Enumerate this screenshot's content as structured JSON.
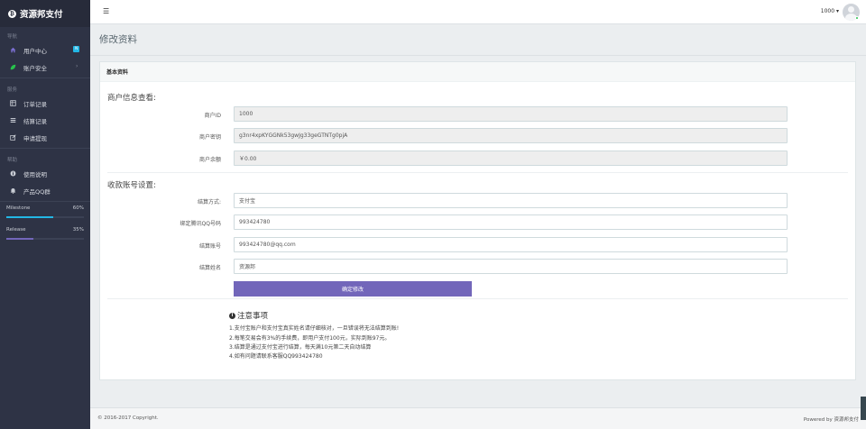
{
  "brand": {
    "logo_glyph": "₿",
    "name": "资源邦支付"
  },
  "sidebar": {
    "sections": [
      {
        "label": "导航"
      },
      {
        "label": "服务"
      },
      {
        "label": "帮助"
      }
    ],
    "items": [
      {
        "label": "用户中心",
        "icon": "home-icon",
        "badge": "N"
      },
      {
        "label": "账户安全",
        "icon": "leaf-icon",
        "arrow": "›"
      },
      {
        "label": "订单记录",
        "icon": "table-icon"
      },
      {
        "label": "结算记录",
        "icon": "list-icon"
      },
      {
        "label": "申请提现",
        "icon": "edit-icon"
      },
      {
        "label": "使用说明",
        "icon": "help-circle-icon"
      },
      {
        "label": "产品QQ群",
        "icon": "bell-icon"
      }
    ],
    "progress": [
      {
        "label": "Milestone",
        "value": "60%",
        "fraction": 0.6,
        "color": "#23b7e5"
      },
      {
        "label": "Release",
        "value": "35%",
        "fraction": 0.35,
        "color": "#7266ba"
      }
    ]
  },
  "topbar": {
    "menu_icon": "☰",
    "user_id": "1000 ▾"
  },
  "page": {
    "title": "修改资料"
  },
  "panel": {
    "heading": "基本资料",
    "merchant_section": "商户信息查看:",
    "merchant_fields": [
      {
        "label": "商户ID",
        "value": "1000"
      },
      {
        "label": "商户密钥",
        "value": "g3nr4xpKYGGNk53gwJg33geGTNTg0pjA"
      },
      {
        "label": "商户余额",
        "value": "￥0.00"
      }
    ],
    "account_section": "收款账号设置:",
    "account_fields": [
      {
        "label": "结算方式:",
        "value": "支付宝"
      },
      {
        "label": "绑定腾讯QQ号码",
        "value": "993424780"
      },
      {
        "label": "结算账号",
        "value": "993424780@qq.com"
      },
      {
        "label": "结算姓名",
        "value": "资源邦"
      }
    ],
    "submit_label": "确定修改",
    "notice_title": "注意事项",
    "notice_lines": [
      "1.支付宝账户和支付宝真实姓名请仔细核对，一旦错误将无法结算到账!",
      "2.每笔交易会有3%的手续费，即用户支付100元，实际到账97元。",
      "3.结算是通过支付宝进行结算，每天满10元第二天自动结算",
      "4.如有问题请联系客服QQ993424780"
    ]
  },
  "footer": {
    "copyright": "© 2016-2017 Copyright.",
    "powered_by": "Powered by 资源邦支付"
  }
}
